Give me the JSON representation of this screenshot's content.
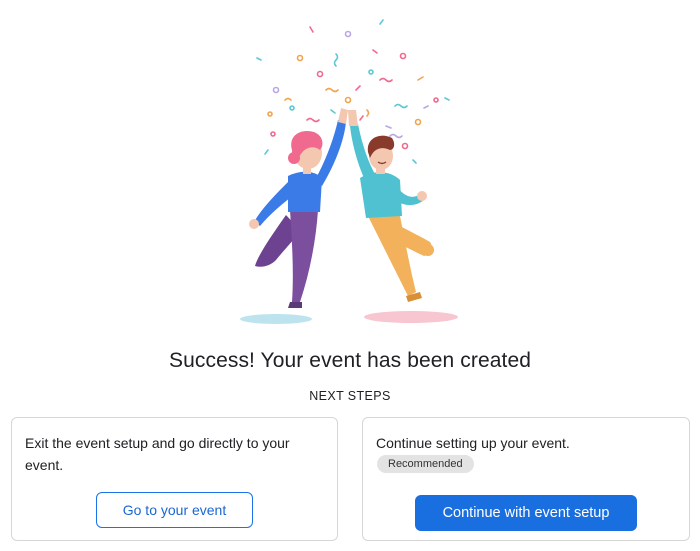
{
  "illustration": {
    "icon": "celebration-high-five-illustration",
    "colors": {
      "woman_hair": "#f06a8f",
      "woman_top": "#3b7be8",
      "woman_pants": "#7b4f9e",
      "man_hair": "#8a3a2a",
      "man_top": "#4fc1d1",
      "man_pants": "#f2b15a",
      "skin": "#f4c7b0",
      "shadow_left": "#bde3ef",
      "shadow_right": "#f7c6d0"
    }
  },
  "heading": {
    "title": "Success! Your event has been created",
    "subtitle": "NEXT STEPS"
  },
  "cards": {
    "left": {
      "text": "Exit the event setup and go directly to your event.",
      "button_label": "Go to your event"
    },
    "right": {
      "text": "Continue setting up your event.",
      "badge": "Recommended",
      "button_label": "Continue with event setup"
    }
  },
  "colors": {
    "accent": "#1a6fe0",
    "card_border": "#d6d6d6",
    "badge_bg": "#e3e3e3"
  }
}
